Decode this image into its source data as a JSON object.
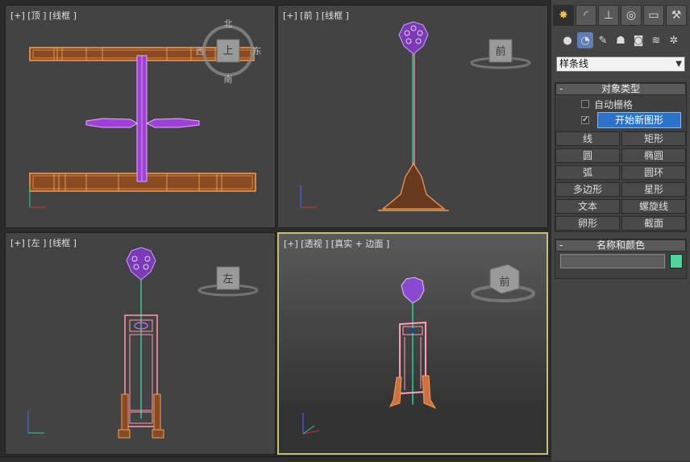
{
  "viewports": {
    "top": {
      "label": "[+] [顶 ] [线框 ]",
      "compass": {
        "n": "北",
        "s": "南",
        "w": "西",
        "e": "东"
      },
      "cube_label": "上"
    },
    "front": {
      "label": "[+] [前 ] [线框 ]",
      "cube_label": "前"
    },
    "left": {
      "label": "[+] [左 ] [线框 ]",
      "cube_label": "左"
    },
    "perspective": {
      "label": "[+] [透视 ] [真实 + 边面 ]",
      "cube_label": "前"
    }
  },
  "panel": {
    "tabs": [
      "create-icon",
      "modify-icon",
      "hierarchy-icon",
      "motion-icon",
      "display-icon",
      "utilities-icon"
    ],
    "subcategories": [
      "geometry-icon",
      "shapes-icon",
      "lights-icon",
      "cameras-icon",
      "helpers-icon",
      "spacewarps-icon",
      "systems-icon"
    ],
    "dropdown_value": "样条线",
    "object_type": {
      "title": "对象类型",
      "auto_grid": "自动栅格",
      "start_new_shape": "开始新图形",
      "buttons": [
        "线",
        "矩形",
        "圆",
        "椭圆",
        "弧",
        "圆环",
        "多边形",
        "星形",
        "文本",
        "螺旋线",
        "卵形",
        "截面"
      ]
    },
    "name_color": {
      "title": "名称和颜色",
      "name_value": "",
      "color": "#4fd59c"
    }
  }
}
